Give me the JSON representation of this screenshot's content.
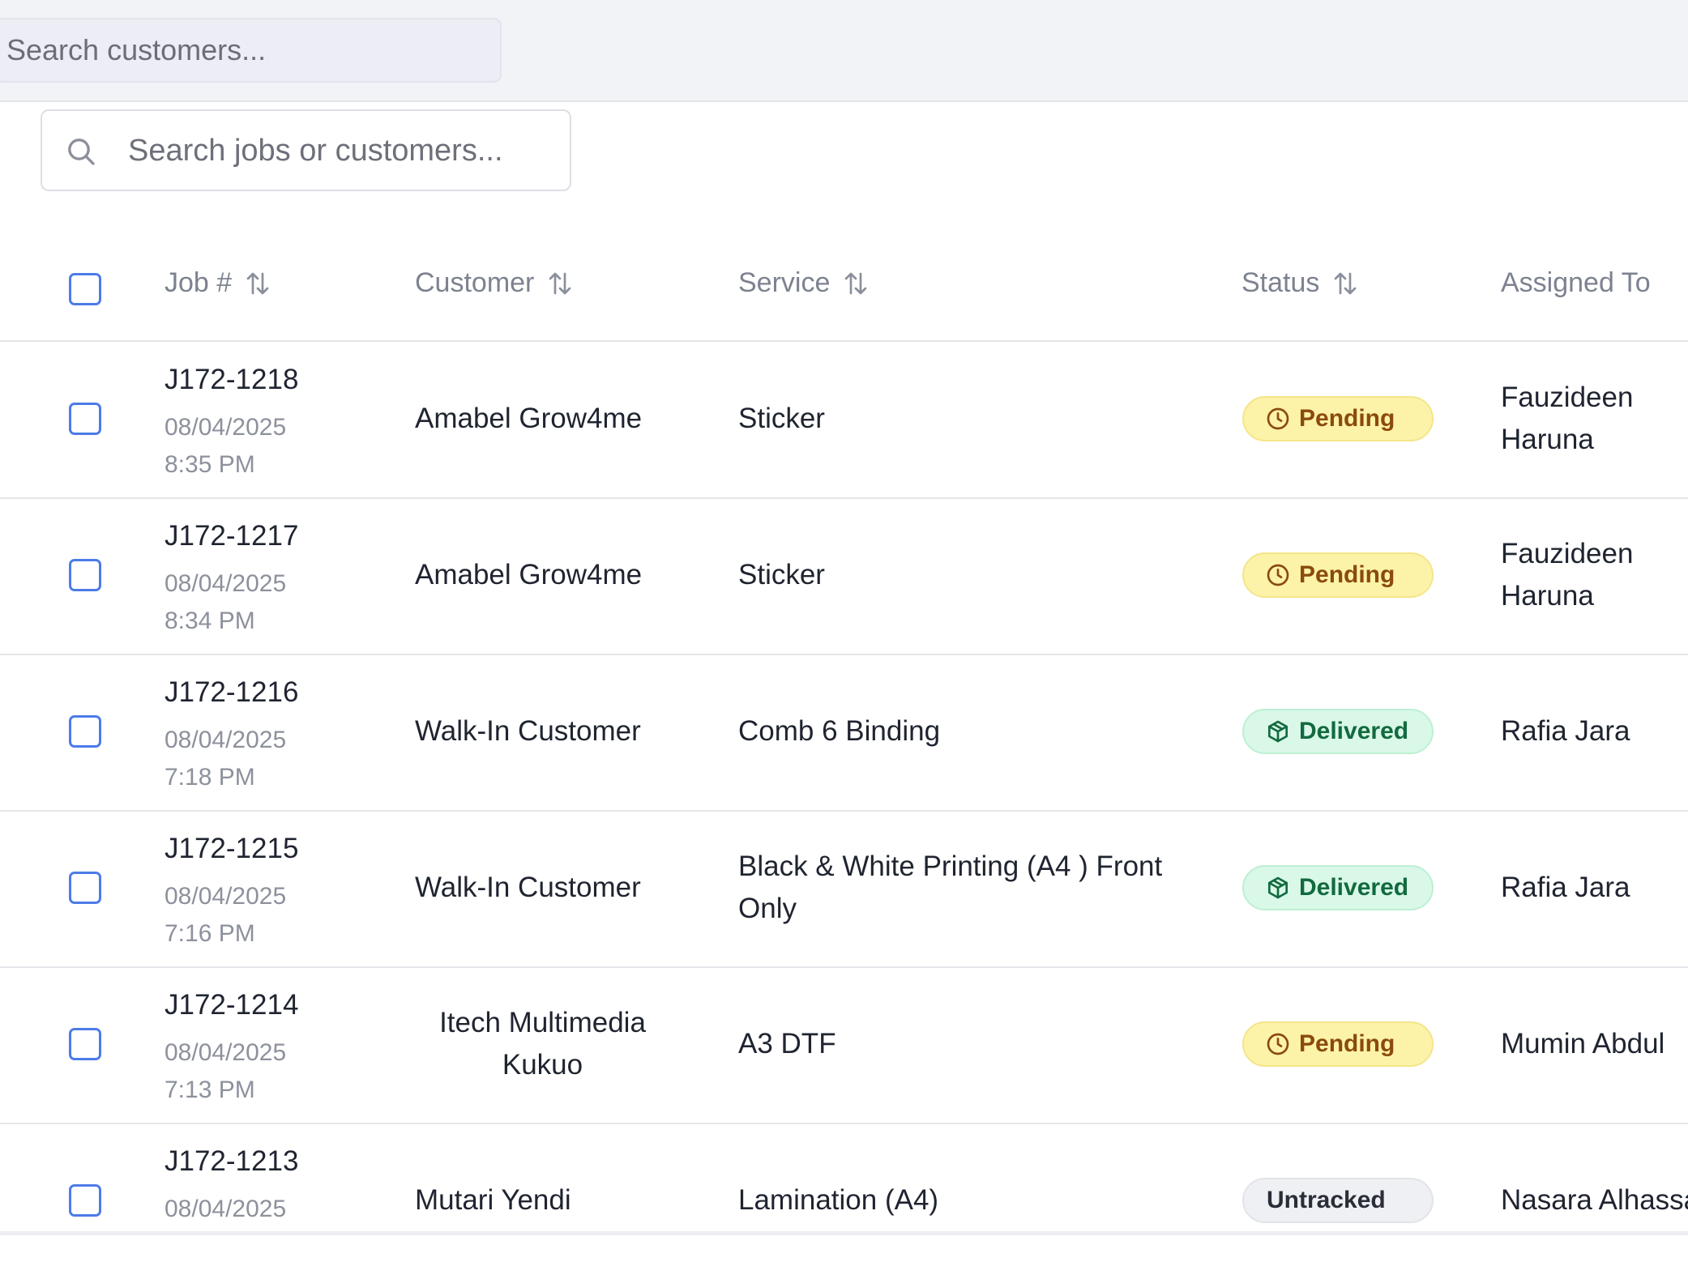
{
  "top_search": {
    "placeholder": "Search customers..."
  },
  "job_search": {
    "placeholder": "Search jobs or customers..."
  },
  "table": {
    "headers": {
      "job": "Job #",
      "customer": "Customer",
      "service": "Service",
      "status": "Status",
      "assigned": "Assigned To"
    },
    "rows": [
      {
        "job": "J172-1218",
        "date": "08/04/2025",
        "time": "8:35 PM",
        "customer_line1": "Amabel Grow4me",
        "customer_line2": "",
        "service_line1": "Sticker",
        "service_line2": "",
        "status": "Pending",
        "assigned_line1": "Fauzideen",
        "assigned_line2": "Haruna"
      },
      {
        "job": "J172-1217",
        "date": "08/04/2025",
        "time": "8:34 PM",
        "customer_line1": "Amabel Grow4me",
        "customer_line2": "",
        "service_line1": "Sticker",
        "service_line2": "",
        "status": "Pending",
        "assigned_line1": "Fauzideen",
        "assigned_line2": "Haruna"
      },
      {
        "job": "J172-1216",
        "date": "08/04/2025",
        "time": "7:18 PM",
        "customer_line1": "Walk-In Customer",
        "customer_line2": "",
        "service_line1": "Comb 6 Binding",
        "service_line2": "",
        "status": "Delivered",
        "assigned_line1": "Rafia Jara",
        "assigned_line2": ""
      },
      {
        "job": "J172-1215",
        "date": "08/04/2025",
        "time": "7:16 PM",
        "customer_line1": "Walk-In Customer",
        "customer_line2": "",
        "service_line1": "Black & White Printing (A4 ) Front",
        "service_line2": "Only",
        "status": "Delivered",
        "assigned_line1": "Rafia Jara",
        "assigned_line2": ""
      },
      {
        "job": "J172-1214",
        "date": "08/04/2025",
        "time": "7:13 PM",
        "customer_line1": "Itech Multimedia",
        "customer_line2": "Kukuo",
        "service_line1": "A3 DTF",
        "service_line2": "",
        "status": "Pending",
        "assigned_line1": "Mumin Abdul",
        "assigned_line2": ""
      },
      {
        "job": "J172-1213",
        "date": "08/04/2025",
        "time": "",
        "customer_line1": "Mutari Yendi",
        "customer_line2": "",
        "service_line1": "Lamination (A4)",
        "service_line2": "",
        "status": "Untracked",
        "assigned_line1": "Nasara Alhassan",
        "assigned_line2": ""
      }
    ]
  },
  "colors": {
    "checkbox": "#4c7be8",
    "pending_bg": "#fdf3a8",
    "pending_text": "#8a4b0c",
    "delivered_bg": "#d9f8e8",
    "delivered_text": "#126a3e",
    "untracked_bg": "#eef0f3"
  },
  "icons": {
    "search": "search-icon",
    "sort": "sort-icon",
    "pending": "clock-icon",
    "delivered": "package-icon"
  }
}
